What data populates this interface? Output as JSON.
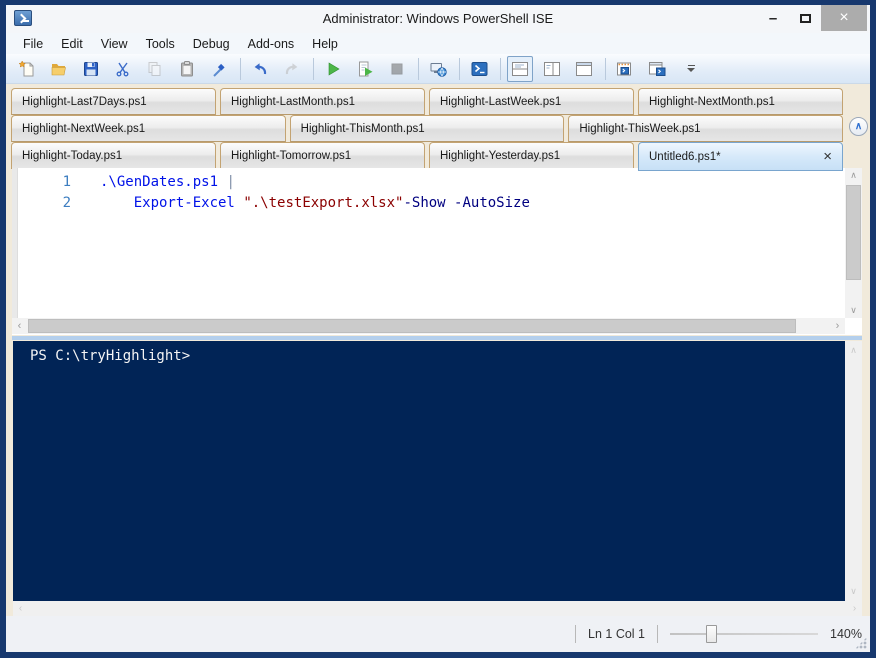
{
  "window": {
    "title": "Administrator: Windows PowerShell ISE"
  },
  "menu": {
    "items": [
      "File",
      "Edit",
      "View",
      "Tools",
      "Debug",
      "Add-ons",
      "Help"
    ]
  },
  "toolbar": {
    "buttons": [
      "new-script",
      "open-script",
      "save",
      "cut",
      "copy",
      "paste",
      "clear-console-pane",
      "undo",
      "redo",
      "run-script",
      "run-selection",
      "stop-operation",
      "new-remote-powershell-tab",
      "start-powershell-exe",
      "show-script-pane-top",
      "show-script-pane-right",
      "show-script-pane-maximized",
      "new-powershell-tab",
      "show-script-pane",
      "toolbar-overflow"
    ],
    "selected": "show-script-pane-top",
    "disabled": [
      "copy",
      "redo",
      "stop-operation"
    ]
  },
  "tabs": {
    "rows": [
      [
        {
          "label": "Highlight-Last7Days.ps1"
        },
        {
          "label": "Highlight-LastMonth.ps1"
        },
        {
          "label": "Highlight-LastWeek.ps1"
        },
        {
          "label": "Highlight-NextMonth.ps1"
        }
      ],
      [
        {
          "label": "Highlight-NextWeek.ps1"
        },
        {
          "label": "Highlight-ThisMonth.ps1"
        },
        {
          "label": "Highlight-ThisWeek.ps1"
        }
      ],
      [
        {
          "label": "Highlight-Today.ps1"
        },
        {
          "label": "Highlight-Tomorrow.ps1"
        },
        {
          "label": "Highlight-Yesterday.ps1"
        },
        {
          "label": "Untitled6.ps1*",
          "active": true,
          "closable": true
        }
      ]
    ]
  },
  "editor": {
    "lines": [
      {
        "number": "1",
        "segments": [
          {
            "type": "command",
            "text": ".\\GenDates.ps1"
          },
          {
            "type": "plain",
            "text": " "
          },
          {
            "type": "operator",
            "text": "|"
          }
        ]
      },
      {
        "number": "2",
        "segments": [
          {
            "type": "plain",
            "text": "    "
          },
          {
            "type": "command",
            "text": "Export-Excel"
          },
          {
            "type": "plain",
            "text": " "
          },
          {
            "type": "string",
            "text": "\".\\testExport.xlsx\""
          },
          {
            "type": "parameter",
            "text": "-Show -AutoSize"
          }
        ]
      }
    ]
  },
  "console": {
    "prompt": "PS C:\\tryHighlight>"
  },
  "statusbar": {
    "position": "Ln 1 Col 1",
    "zoom": "140%"
  },
  "icons": {
    "minimize": "–",
    "close": "×",
    "chevron_up": "∧",
    "chevron_down": "∨",
    "chevron_left": "‹",
    "chevron_right": "›"
  },
  "colors": {
    "window_border": "#17386E",
    "console_background": "#012456",
    "tab_area_background": "#F1EADB",
    "active_tab": "#C7E0F6",
    "token_command": "#0012E8",
    "token_string": "#8B0000",
    "token_parameter": "#000080",
    "line_number": "#3C7DC0"
  }
}
